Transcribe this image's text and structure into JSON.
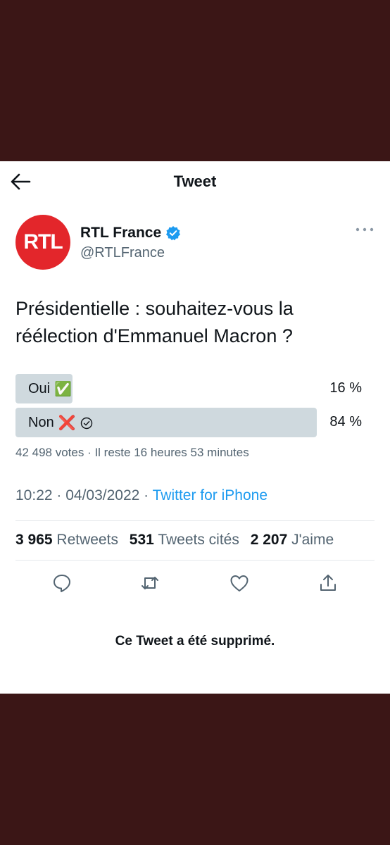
{
  "header": {
    "title": "Tweet",
    "back_icon": "arrow-left-icon"
  },
  "author": {
    "avatar_text": "RTL",
    "avatar_color": "#e3262b",
    "name": "RTL France",
    "handle": "@RTLFrance",
    "verified": true
  },
  "tweet": {
    "text": "Présidentielle : souhaitez-vous la réélection d'Emmanuel Macron ?"
  },
  "poll": {
    "options": [
      {
        "label": "Oui",
        "emoji": "✅",
        "percent_text": "16 %",
        "percent": 16,
        "selected": false
      },
      {
        "label": "Non",
        "emoji": "❌",
        "percent_text": "84 %",
        "percent": 84,
        "selected": true
      }
    ],
    "summary": "42 498 votes · Il reste 16 heures 53 minutes"
  },
  "meta": {
    "time": "10:22 · 04/03/2022 · ",
    "source": "Twitter for iPhone"
  },
  "stats": {
    "retweets_count": "3 965",
    "retweets_label": "Retweets",
    "quotes_count": "531",
    "quotes_label": "Tweets cités",
    "likes_count": "2 207",
    "likes_label": "J'aime"
  },
  "actions": [
    "reply-icon",
    "retweet-icon",
    "like-icon",
    "share-icon"
  ],
  "deleted_notice": "Ce Tweet a été supprimé.",
  "colors": {
    "background": "#3b1616",
    "link": "#1d9bf0",
    "poll_bar": "#cfd9de",
    "verified": "#1d9bf0"
  }
}
